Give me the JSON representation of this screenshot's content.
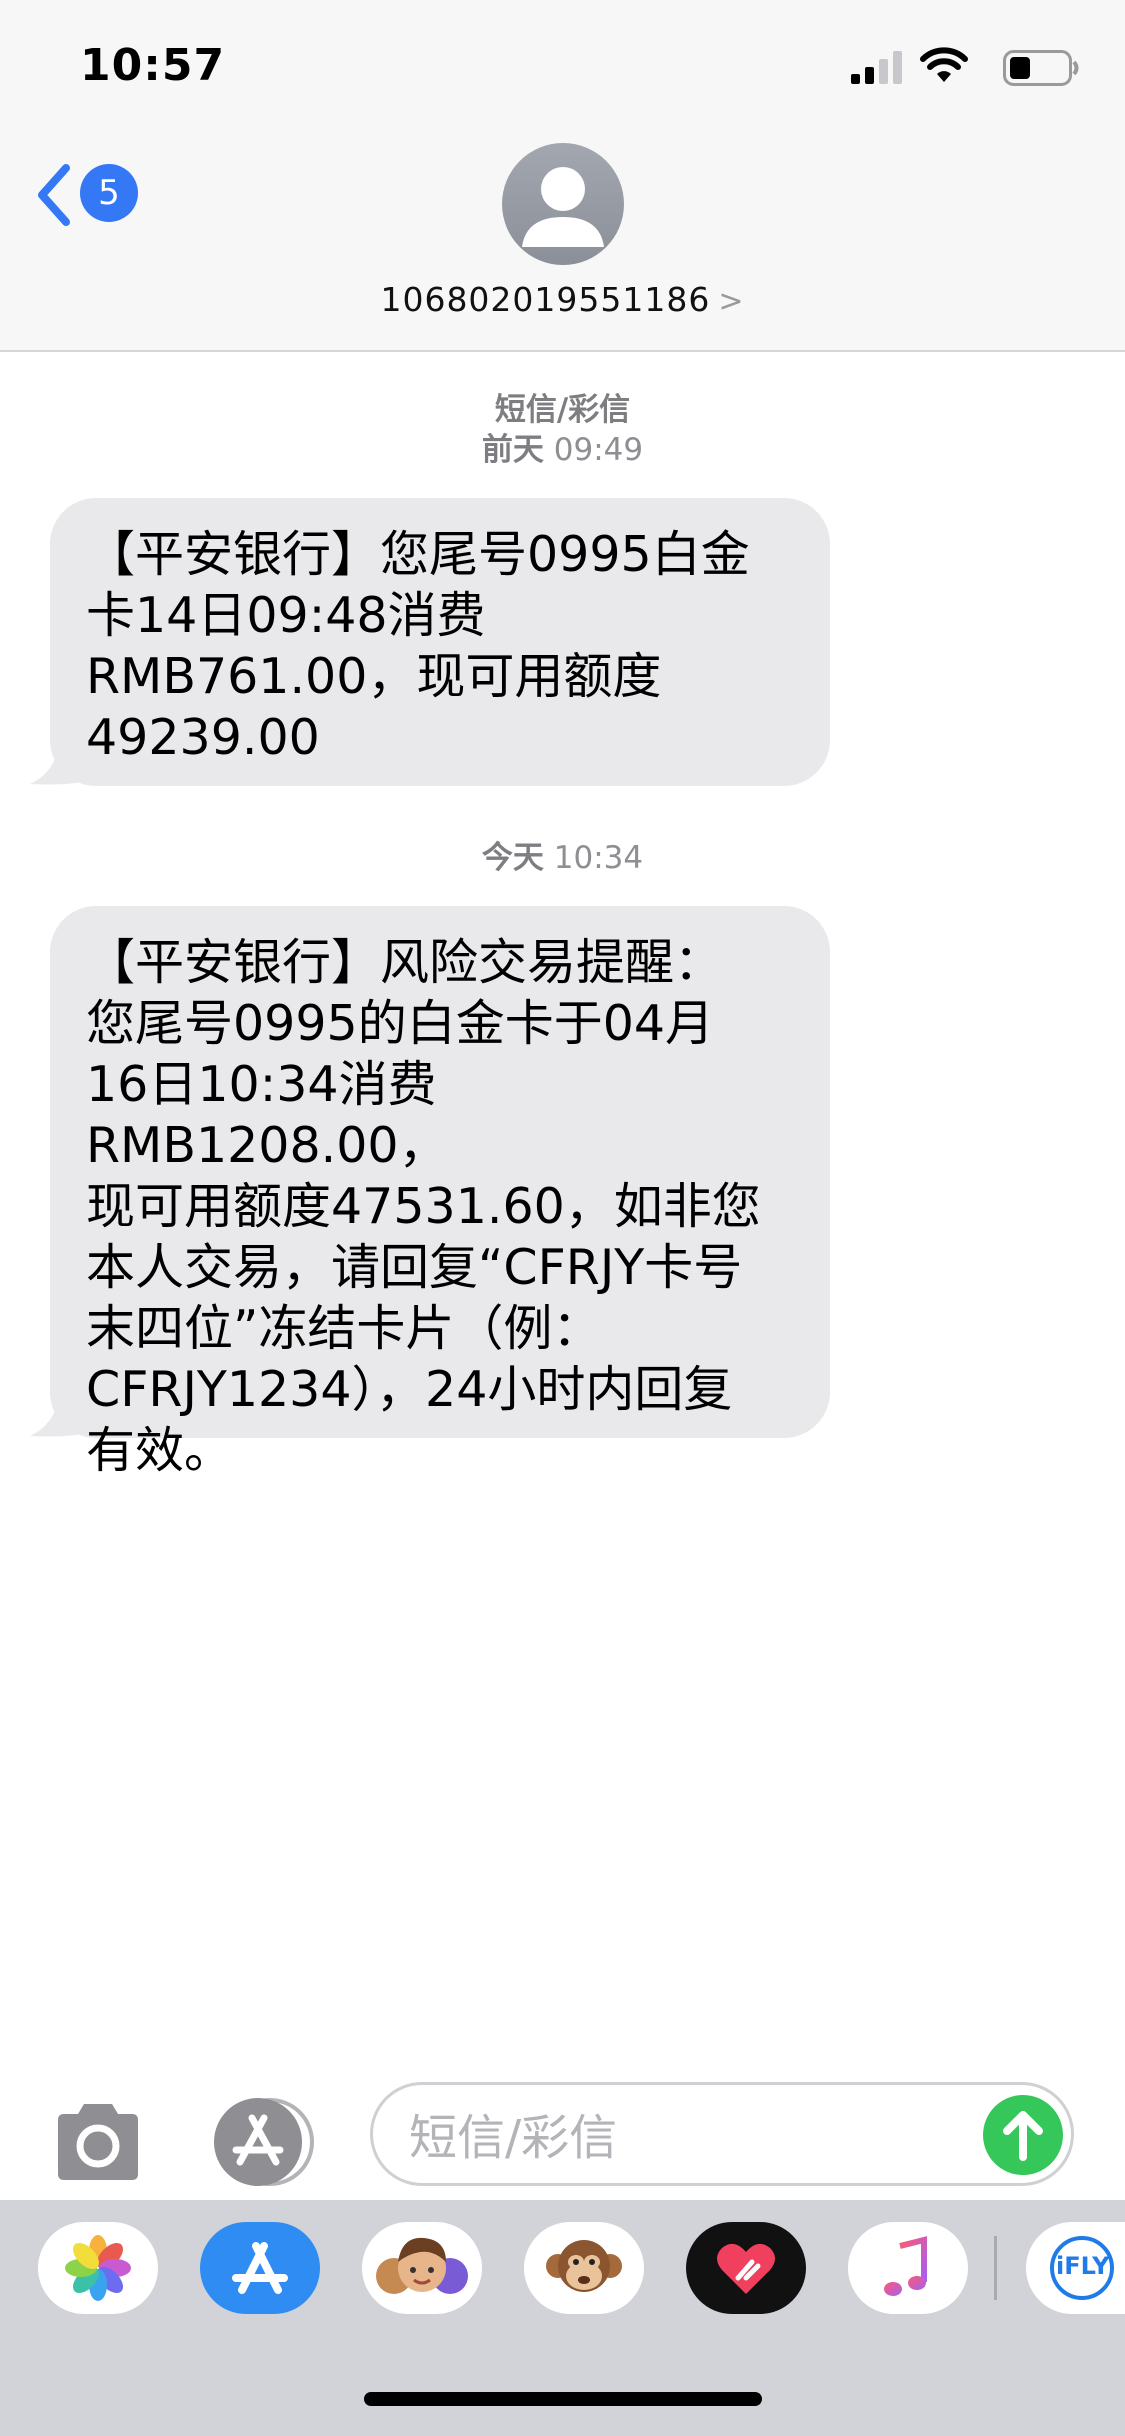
{
  "status_bar": {
    "time": "10:57"
  },
  "nav": {
    "back_count": "5",
    "contact_name": "106802019551186",
    "contact_chevron": ">"
  },
  "conversation": {
    "service_label": "短信/彩信",
    "messages": [
      {
        "timestamp_day": "前天",
        "timestamp_time": "09:49",
        "lines": [
          "【平安银行】您尾号0995白金",
          "卡14日09:48消费",
          "RMB761.00，现可用额度",
          "49239.00"
        ]
      },
      {
        "timestamp_day": "今天",
        "timestamp_time": "10:34",
        "lines": [
          "【平安银行】风险交易提醒：",
          "您尾号0995的白金卡于04月",
          "16日10:34消费RMB1208.00，",
          "现可用额度47531.60，如非您",
          "本人交易，请回复“CFRJY卡号",
          "末四位”冻结卡片（例：",
          "CFRJY1234），24小时内回复",
          "有效。"
        ]
      }
    ]
  },
  "composer": {
    "placeholder": "短信/彩信"
  },
  "dock": {
    "apps": [
      "photos-app",
      "app-store-app",
      "memoji-app",
      "animoji-monkey-app",
      "digital-touch-app",
      "music-app",
      "ifly-app"
    ],
    "ifly_label": "iFLY"
  },
  "colors": {
    "accent_blue": "#3478f6",
    "bubble_gray": "#e9e9eb",
    "send_green": "#35c759",
    "timestamp_gray": "#8e8e93"
  }
}
